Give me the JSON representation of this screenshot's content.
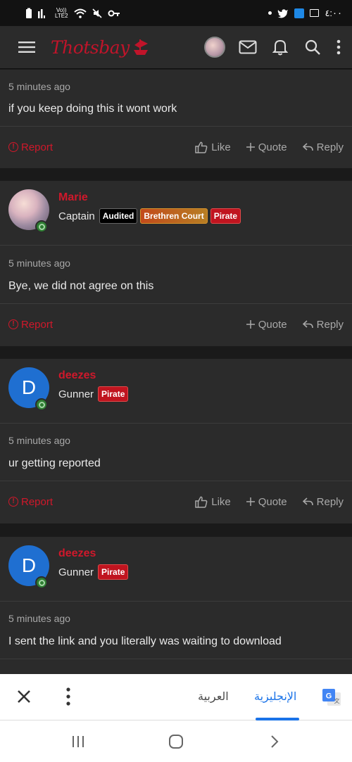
{
  "status_bar": {
    "time": "٤:٠٠",
    "carrier_top": "Vo))",
    "carrier_bottom": "LTE2"
  },
  "app": {
    "logo_text": "Thotsbay"
  },
  "posts": [
    {
      "timestamp": "5 minutes ago",
      "message": "if you keep doing this it wont work",
      "actions": {
        "report": "Report",
        "like": "Like",
        "quote": "Quote",
        "reply": "Reply"
      }
    },
    {
      "username": "Marie",
      "rank": "Captain",
      "avatar_type": "photo",
      "badges": [
        "Audited",
        "Brethren Court",
        "Pirate"
      ],
      "timestamp": "5 minutes ago",
      "message": "Bye, we did not agree on this",
      "actions": {
        "report": "Report",
        "quote": "Quote",
        "reply": "Reply"
      }
    },
    {
      "username": "deezes",
      "rank": "Gunner",
      "avatar_letter": "D",
      "badges": [
        "Pirate"
      ],
      "timestamp": "5 minutes ago",
      "message": "ur getting reported",
      "actions": {
        "report": "Report",
        "like": "Like",
        "quote": "Quote",
        "reply": "Reply"
      }
    },
    {
      "username": "deezes",
      "rank": "Gunner",
      "avatar_letter": "D",
      "badges": [
        "Pirate"
      ],
      "timestamp": "5 minutes ago",
      "message": "I sent the link and you literally was waiting to download"
    }
  ],
  "translate_bar": {
    "source_language": "العربية",
    "target_language": "الإنجليزية",
    "selected": "target_language"
  },
  "icons": {
    "menu": "menu-icon",
    "mail": "mail-icon",
    "bell": "bell-icon",
    "search": "search-icon",
    "more": "more-vert-icon",
    "online": "online-status-icon",
    "like": "thumbs-up-icon",
    "quote": "plus-icon",
    "reply": "reply-icon",
    "report": "alert-circle-icon",
    "close": "close-icon",
    "google_translate": "google-translate-icon"
  },
  "colors": {
    "accent_red": "#d0182b",
    "card_bg": "#2b2b2b",
    "page_bg": "#1a1a1a",
    "link_blue": "#1a73e8",
    "avatar_blue": "#1f6fd1"
  }
}
